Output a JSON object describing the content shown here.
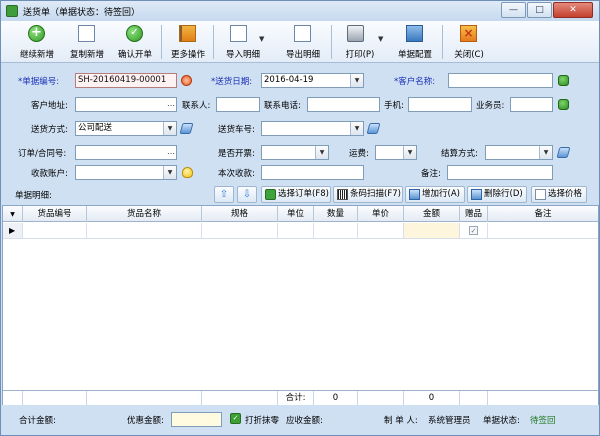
{
  "window": {
    "title": "送货单（单据状态：待签回）",
    "minimize": "0",
    "maximize": "1",
    "close": "r"
  },
  "toolbar": {
    "continue_new": "继续新增",
    "copy_new": "复制新增",
    "confirm_bill": "确认开单",
    "more_ops": "更多操作",
    "import_detail": "导入明细",
    "export_detail": "导出明细",
    "print": "打印(P)",
    "bill_config": "单据配置",
    "close": "关闭(C)"
  },
  "form": {
    "bill_no_label": "*单据编号:",
    "bill_no_value": "SH-20160419-00001",
    "delivery_date_label": "*送货日期:",
    "delivery_date_value": "2016-04-19",
    "customer_name_label": "*客户名称:",
    "customer_name_value": "",
    "customer_addr_label": "客户地址:",
    "contact_label": "联系人:",
    "phone_label": "联系电话:",
    "mobile_label": "手机:",
    "salesman_label": "业务员:",
    "delivery_method_label": "送货方式:",
    "delivery_method_value": "公司配送",
    "vehicle_no_label": "送货车号:",
    "order_contract_label": "订单/合同号:",
    "invoice_label": "是否开票:",
    "freight_label": "运费:",
    "settle_label": "结算方式:",
    "receive_account_label": "收款账户:",
    "this_receive_label": "本次收款:",
    "remark_label": "备注:"
  },
  "detail_bar": {
    "label": "单据明细:",
    "select_order": "选择订单(F8)",
    "barcode_scan": "条码扫描(F7)",
    "add_row": "增加行(A)",
    "delete_row": "删除行(D)",
    "select_price": "选择价格"
  },
  "grid": {
    "columns": [
      "货品编号",
      "货品名称",
      "规格",
      "单位",
      "数量",
      "单价",
      "金额",
      "赠品",
      "备注"
    ],
    "total_label": "合计:",
    "total_qty": "0",
    "total_amount": "0"
  },
  "footer": {
    "total_amount_label": "合计金额:",
    "discount_label": "优惠金额:",
    "discount_round": "打折抹零",
    "receivable_label": "应收金额:",
    "maker_label": "制 单 人:",
    "maker_value": "系统管理员",
    "status_label": "单据状态:",
    "status_value": "待签回"
  }
}
